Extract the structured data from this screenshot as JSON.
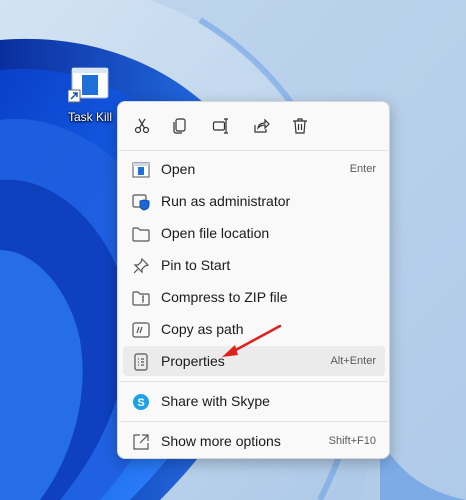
{
  "desktop": {
    "shortcut_label": "Task Kill",
    "accent": "#1565e8"
  },
  "quick_actions": [
    {
      "name": "cut-icon"
    },
    {
      "name": "copy-icon"
    },
    {
      "name": "rename-icon"
    },
    {
      "name": "share-icon"
    },
    {
      "name": "delete-icon"
    }
  ],
  "menu": {
    "open": {
      "label": "Open",
      "shortcut": "Enter"
    },
    "run_admin": {
      "label": "Run as administrator"
    },
    "open_location": {
      "label": "Open file location"
    },
    "pin_start": {
      "label": "Pin to Start"
    },
    "compress_zip": {
      "label": "Compress to ZIP file"
    },
    "copy_path": {
      "label": "Copy as path"
    },
    "properties": {
      "label": "Properties",
      "shortcut": "Alt+Enter"
    },
    "share_skype": {
      "label": "Share with Skype"
    },
    "show_more": {
      "label": "Show more options",
      "shortcut": "Shift+F10"
    }
  },
  "annotation": {
    "arrow_color": "#e0201c"
  }
}
